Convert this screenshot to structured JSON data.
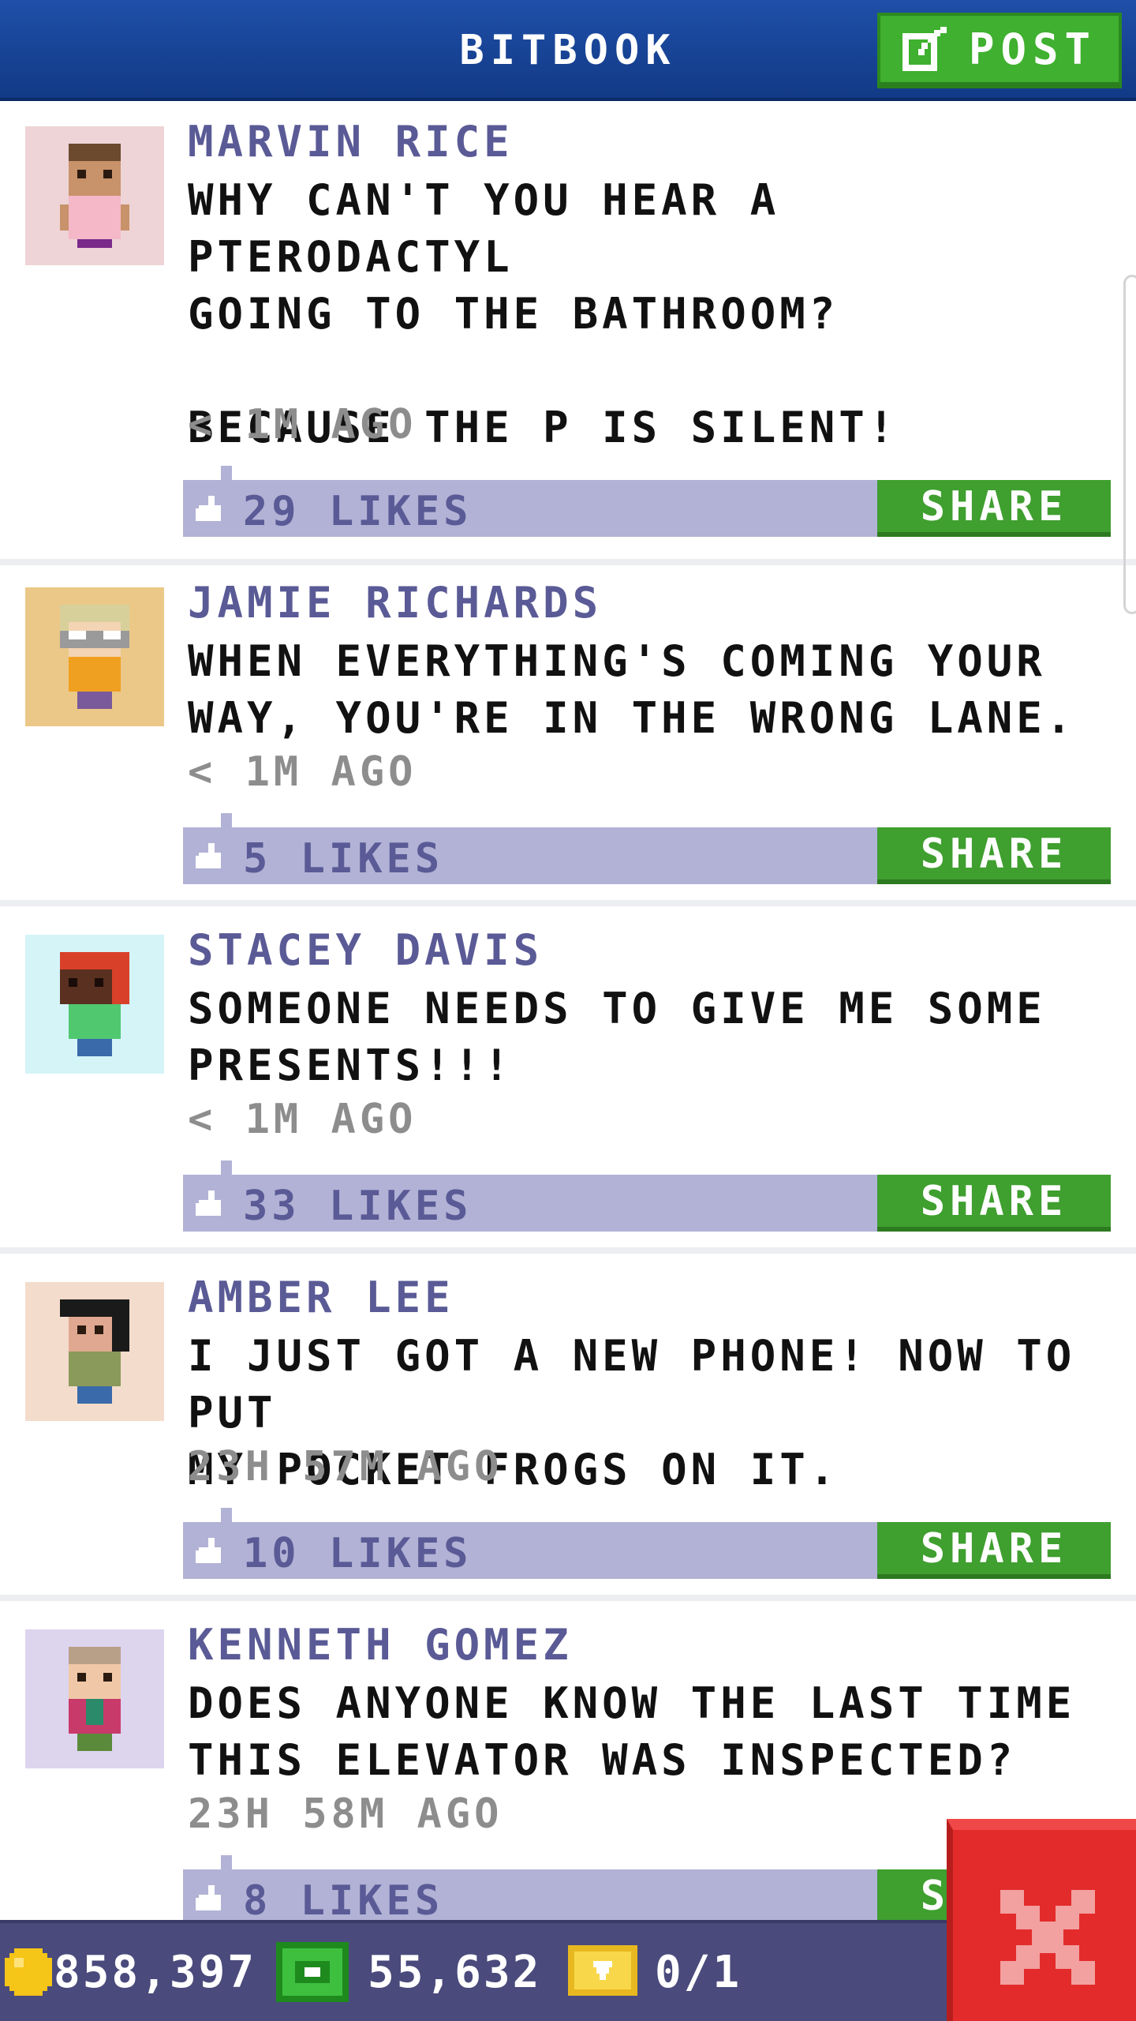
{
  "header": {
    "title": "BITBOOK",
    "post_label": "POST"
  },
  "posts": [
    {
      "author": "MARVIN RICE",
      "text": "WHY CAN'T YOU HEAR A PTERODACTYL\nGOING TO THE BATHROOM?\n\nBECAUSE THE P IS SILENT!",
      "time": "< 1M AGO",
      "likes": "29 LIKES",
      "share": "SHARE",
      "avatar_bg": "#eed4d6"
    },
    {
      "author": "JAMIE RICHARDS",
      "text": "WHEN EVERYTHING'S COMING YOUR\nWAY, YOU'RE IN THE WRONG LANE.",
      "time": "< 1M AGO",
      "likes": "5 LIKES",
      "share": "SHARE",
      "avatar_bg": "#ebc888"
    },
    {
      "author": "STACEY DAVIS",
      "text": "SOMEONE NEEDS TO GIVE ME SOME\nPRESENTS!!!",
      "time": "< 1M AGO",
      "likes": "33 LIKES",
      "share": "SHARE",
      "avatar_bg": "#d4f4f8"
    },
    {
      "author": "AMBER LEE",
      "text": "I JUST GOT A NEW PHONE! NOW TO PUT\nMY POCKET FROGS ON IT.",
      "time": "23H 57M AGO",
      "likes": "10 LIKES",
      "share": "SHARE",
      "avatar_bg": "#f4dccc"
    },
    {
      "author": "KENNETH GOMEZ",
      "text": "DOES ANYONE KNOW THE LAST TIME\nTHIS ELEVATOR WAS INSPECTED?",
      "time": "23H 58M AGO",
      "likes": "8 LIKES",
      "share": "SHARE",
      "avatar_bg": "#ddd4ee"
    }
  ],
  "status_bar": {
    "coins": "858,397",
    "bux": "55,632",
    "tickets": "0/1"
  },
  "icons": {
    "post": "edit-icon",
    "like": "thumbs-up-icon",
    "coin": "coin-icon",
    "bux": "cash-icon",
    "ticket": "ticket-icon",
    "close": "close-icon"
  }
}
